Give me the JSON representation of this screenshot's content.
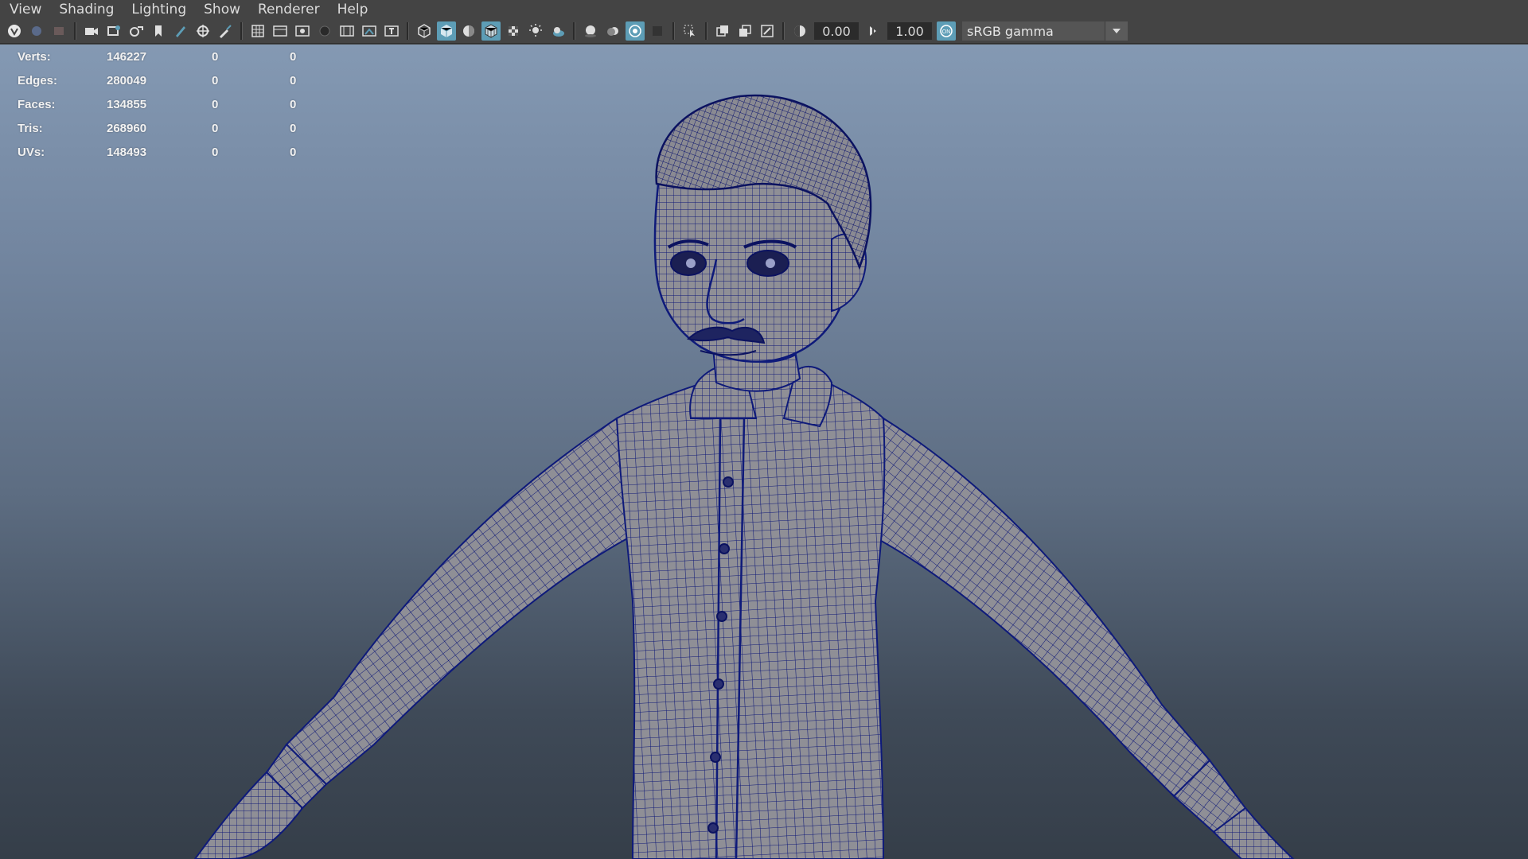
{
  "menu": [
    "View",
    "Shading",
    "Lighting",
    "Show",
    "Renderer",
    "Help"
  ],
  "toolbar": {
    "exposure_value": "0.00",
    "gamma_value": "1.00",
    "color_space": "sRGB gamma",
    "colors": {
      "active": "#5d9db6",
      "background": "#444444"
    }
  },
  "hud": {
    "rows": [
      {
        "label": "Verts:",
        "value": "146227",
        "selected": "0",
        "component": "0"
      },
      {
        "label": "Edges:",
        "value": "280049",
        "selected": "0",
        "component": "0"
      },
      {
        "label": "Faces:",
        "value": "134855",
        "selected": "0",
        "component": "0"
      },
      {
        "label": "Tris:",
        "value": "268960",
        "selected": "0",
        "component": "0"
      },
      {
        "label": "UVs:",
        "value": "148493",
        "selected": "0",
        "component": "0"
      }
    ]
  },
  "viewport": {
    "background_top": "#8499b3",
    "background_bottom": "#353e49",
    "wireframe_color": "#0e1a7a",
    "mesh_color": "#8f8f96"
  }
}
